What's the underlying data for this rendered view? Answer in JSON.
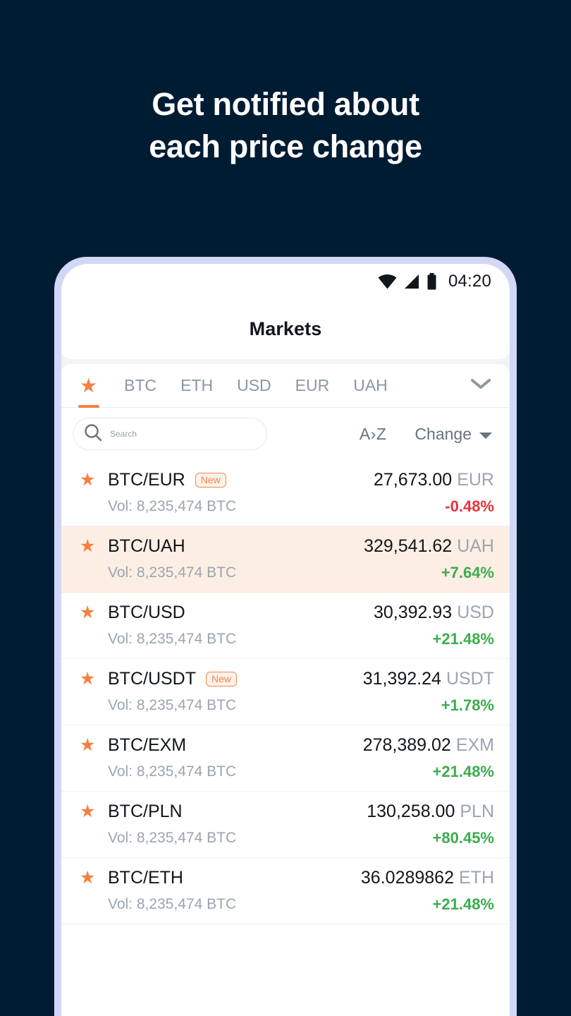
{
  "headline": {
    "line1": "Get notified about",
    "line2": "each price change"
  },
  "colors": {
    "background": "#001c33",
    "frame": "#d3d7f7",
    "accent_orange": "#f3813f",
    "positive_green": "#3aad4e",
    "negative_red": "#e8333a",
    "highlight_row": "#fdeee4"
  },
  "status_bar": {
    "time": "04:20",
    "icons": [
      "wifi-icon",
      "signal-icon",
      "battery-icon"
    ]
  },
  "header": {
    "title": "Markets"
  },
  "tabs": {
    "items": [
      {
        "label": "★",
        "name": "favorites",
        "active": true
      },
      {
        "label": "BTC",
        "name": "btc",
        "active": false
      },
      {
        "label": "ETH",
        "name": "eth",
        "active": false
      },
      {
        "label": "USD",
        "name": "usd",
        "active": false
      },
      {
        "label": "EUR",
        "name": "eur",
        "active": false
      },
      {
        "label": "UAH",
        "name": "uah",
        "active": false
      }
    ],
    "expand_icon": "chevron-down-icon"
  },
  "filters": {
    "search_placeholder": "Search",
    "search_value": "",
    "search_icon": "search-icon",
    "sort_alpha": "A›Z",
    "sort_change": "Change",
    "sort_change_icon": "caret-down-icon"
  },
  "market_rows": [
    {
      "pair": "BTC/EUR",
      "badge": "New",
      "volume": "Vol: 8,235,474 BTC",
      "price": "27,673.00",
      "currency": "EUR",
      "change": "-0.48%",
      "direction": "down",
      "highlighted": false
    },
    {
      "pair": "BTC/UAH",
      "badge": "",
      "volume": "Vol: 8,235,474 BTC",
      "price": "329,541.62",
      "currency": "UAH",
      "change": "+7.64%",
      "direction": "up",
      "highlighted": true
    },
    {
      "pair": "BTC/USD",
      "badge": "",
      "volume": "Vol: 8,235,474 BTC",
      "price": "30,392.93",
      "currency": "USD",
      "change": "+21.48%",
      "direction": "up",
      "highlighted": false
    },
    {
      "pair": "BTC/USDT",
      "badge": "New",
      "volume": "Vol: 8,235,474 BTC",
      "price": "31,392.24",
      "currency": "USDT",
      "change": "+1.78%",
      "direction": "up",
      "highlighted": false
    },
    {
      "pair": "BTC/EXM",
      "badge": "",
      "volume": "Vol: 8,235,474 BTC",
      "price": "278,389.02",
      "currency": "EXM",
      "change": "+21.48%",
      "direction": "up",
      "highlighted": false
    },
    {
      "pair": "BTC/PLN",
      "badge": "",
      "volume": "Vol: 8,235,474 BTC",
      "price": "130,258.00",
      "currency": "PLN",
      "change": "+80.45%",
      "direction": "up",
      "highlighted": false
    },
    {
      "pair": "BTC/ETH",
      "badge": "",
      "volume": "Vol: 8,235,474 BTC",
      "price": "36.0289862",
      "currency": "ETH",
      "change": "+21.48%",
      "direction": "up",
      "highlighted": false
    }
  ]
}
